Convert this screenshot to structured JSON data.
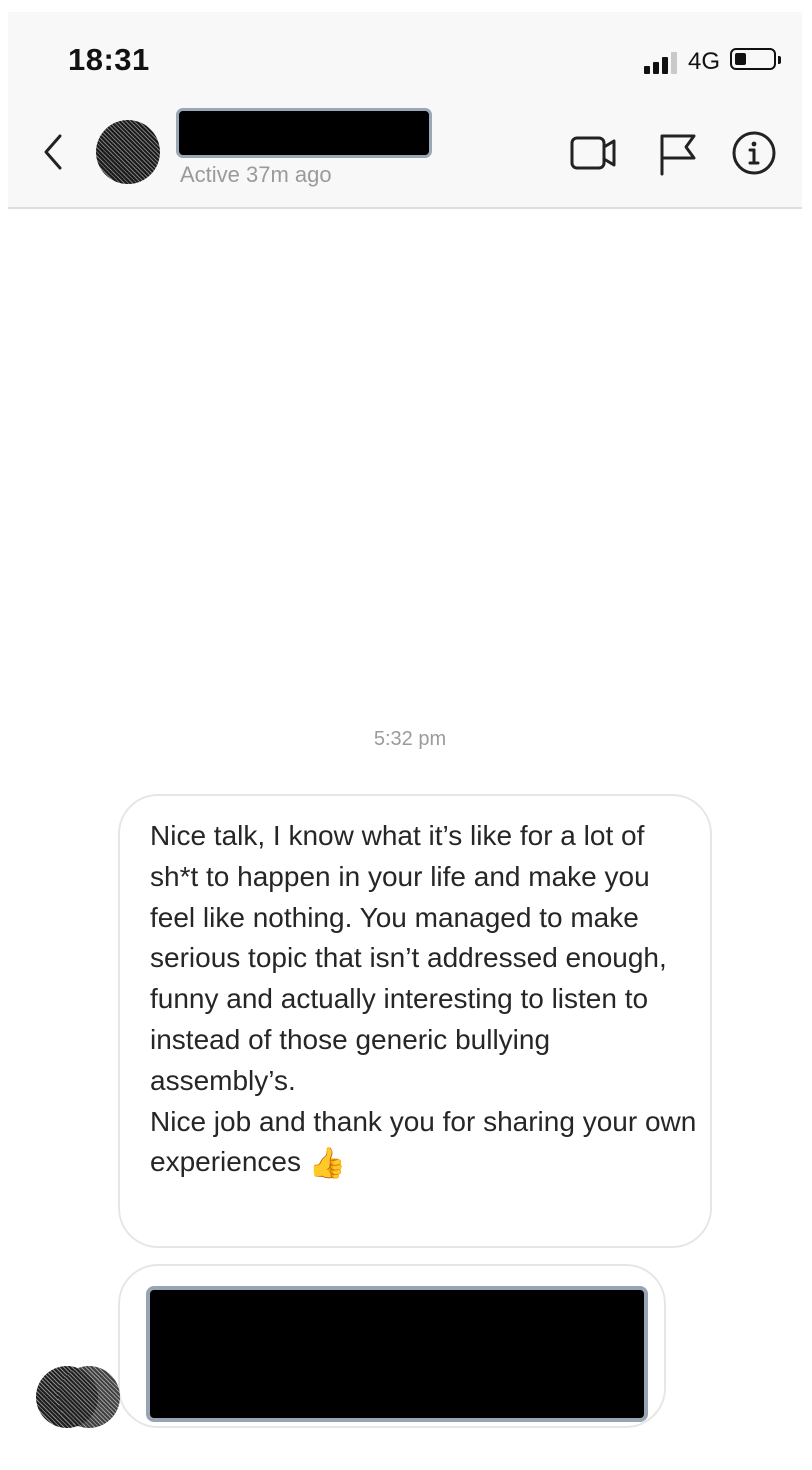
{
  "status_bar": {
    "time": "18:31",
    "network": "4G",
    "signal_bars_active": 3,
    "signal_bars_total": 4,
    "battery_level": 0.3
  },
  "header": {
    "back_icon": "chevron-left-icon",
    "name_redacted": true,
    "active_status": "Active 37m ago",
    "actions": [
      {
        "icon": "video-camera-icon"
      },
      {
        "icon": "flag-icon"
      },
      {
        "icon": "info-icon"
      }
    ]
  },
  "conversation": {
    "timestamp": "5:32 pm",
    "message": {
      "text": "Nice talk, I know what it’s like for a lot of sh*t to happen in your life and make you feel like nothing. You managed to make serious topic that isn’t addressed enough, funny and actually interesting to listen to instead of those generic bullying assembly’s.\nNice job and thank you for sharing your own experiences",
      "emoji": "👍"
    },
    "second_message_redacted": true
  },
  "colors": {
    "header_background": "#f8f8f8",
    "text_primary": "#262626",
    "text_secondary": "#9a9a9a",
    "bubble_border": "#e6e6e6",
    "redaction_border": "#9aa7b6"
  }
}
